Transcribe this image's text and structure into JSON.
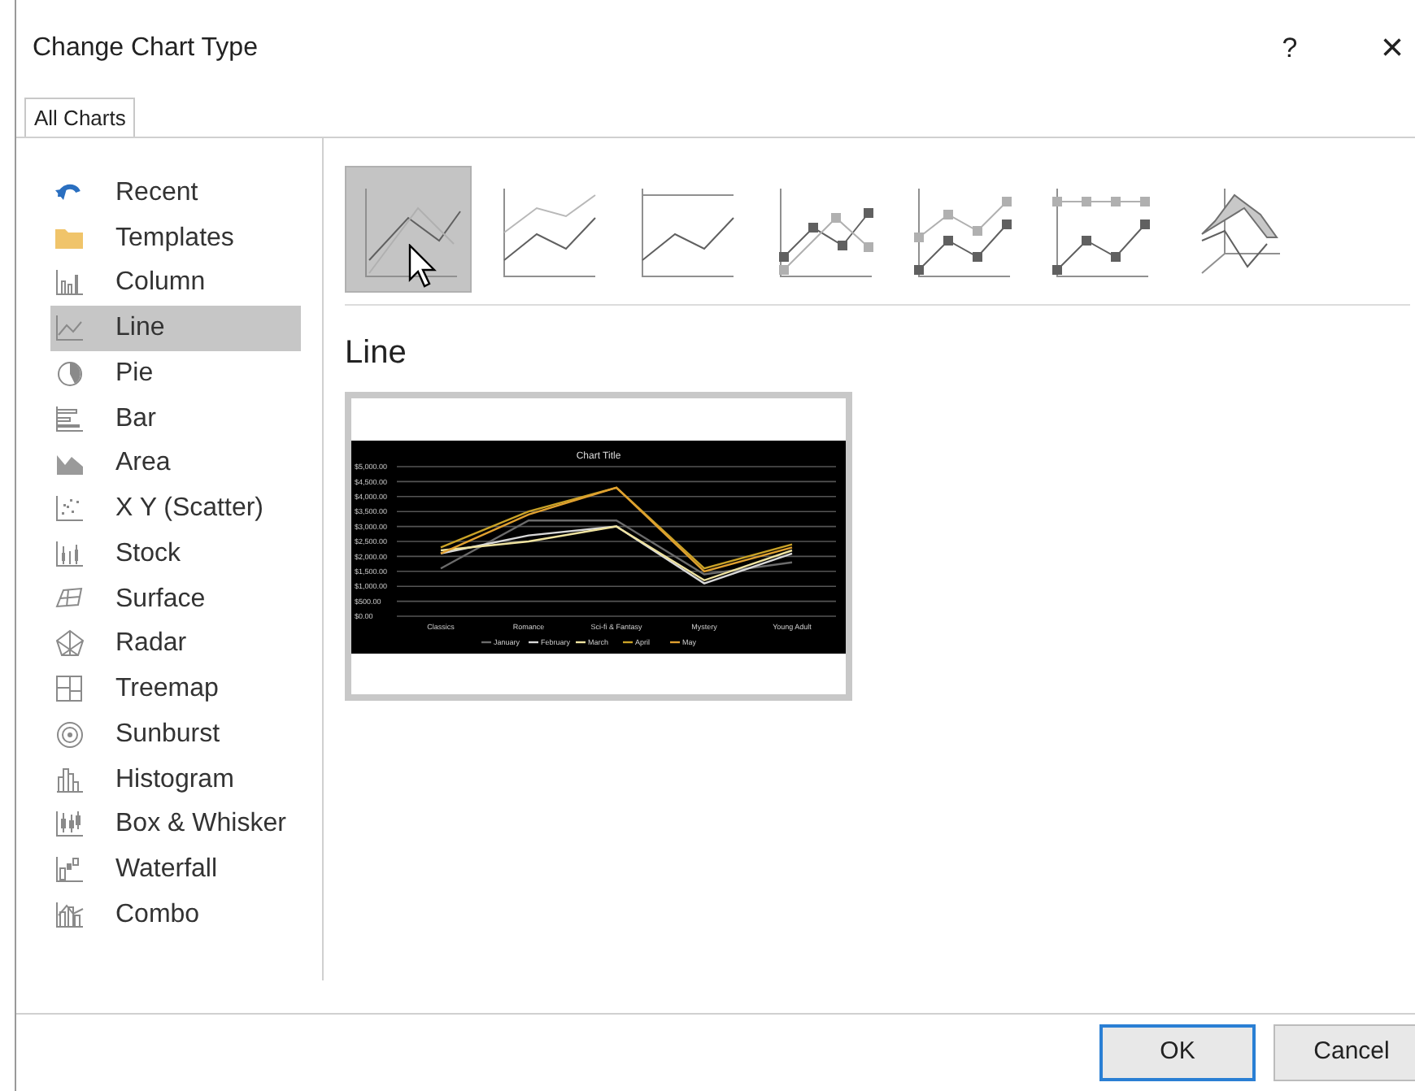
{
  "window": {
    "title": "Change Chart Type",
    "help": "?",
    "close": "×"
  },
  "tabs": [
    {
      "label": "All Charts",
      "selected": true
    }
  ],
  "sidebar": {
    "items": [
      {
        "label": "Recent",
        "selected": false
      },
      {
        "label": "Templates",
        "selected": false
      },
      {
        "label": "Column",
        "selected": false
      },
      {
        "label": "Line",
        "selected": true
      },
      {
        "label": "Pie",
        "selected": false
      },
      {
        "label": "Bar",
        "selected": false
      },
      {
        "label": "Area",
        "selected": false
      },
      {
        "label": "X Y (Scatter)",
        "selected": false
      },
      {
        "label": "Stock",
        "selected": false
      },
      {
        "label": "Surface",
        "selected": false
      },
      {
        "label": "Radar",
        "selected": false
      },
      {
        "label": "Treemap",
        "selected": false
      },
      {
        "label": "Sunburst",
        "selected": false
      },
      {
        "label": "Histogram",
        "selected": false
      },
      {
        "label": "Box & Whisker",
        "selected": false
      },
      {
        "label": "Waterfall",
        "selected": false
      },
      {
        "label": "Combo",
        "selected": false
      }
    ]
  },
  "subtypes": [
    {
      "selected": true
    },
    {
      "selected": false
    },
    {
      "selected": false
    },
    {
      "selected": false
    },
    {
      "selected": false
    },
    {
      "selected": false
    },
    {
      "selected": false
    }
  ],
  "heading": "Line",
  "preview": {
    "chart_data": {
      "type": "line",
      "title": "Chart Title",
      "categories": [
        "Classics",
        "Romance",
        "Sci-fi & Fantasy",
        "Mystery",
        "Young Adult"
      ],
      "ylim": [
        0,
        5000
      ],
      "grid": true,
      "legend": true,
      "yticks": [
        {
          "value": 0,
          "label": "$0.00"
        },
        {
          "value": 500,
          "label": "$500.00"
        },
        {
          "value": 1000,
          "label": "$1,000.00"
        },
        {
          "value": 1500,
          "label": "$1,500.00"
        },
        {
          "value": 2000,
          "label": "$2,000.00"
        },
        {
          "value": 2500,
          "label": "$2,500.00"
        },
        {
          "value": 3000,
          "label": "$3,000.00"
        },
        {
          "value": 3500,
          "label": "$3,500.00"
        },
        {
          "value": 4000,
          "label": "$4,000.00"
        },
        {
          "value": 4500,
          "label": "$4,500.00"
        },
        {
          "value": 5000,
          "label": "$5,000.00"
        }
      ],
      "series": [
        {
          "name": "January",
          "color": "#6b6b6b",
          "values": [
            1600,
            3200,
            3200,
            1400,
            1800
          ]
        },
        {
          "name": "February",
          "color": "#d8d8d8",
          "values": [
            2100,
            2700,
            3000,
            1100,
            2100
          ]
        },
        {
          "name": "March",
          "color": "#efe3a0",
          "values": [
            2200,
            2500,
            3000,
            1200,
            2200
          ]
        },
        {
          "name": "April",
          "color": "#c9a227",
          "values": [
            2300,
            3500,
            4300,
            1600,
            2400
          ]
        },
        {
          "name": "May",
          "color": "#e0a030",
          "values": [
            2100,
            3400,
            4300,
            1500,
            2300
          ]
        }
      ]
    }
  },
  "buttons": [
    "OK",
    "Cancel"
  ]
}
